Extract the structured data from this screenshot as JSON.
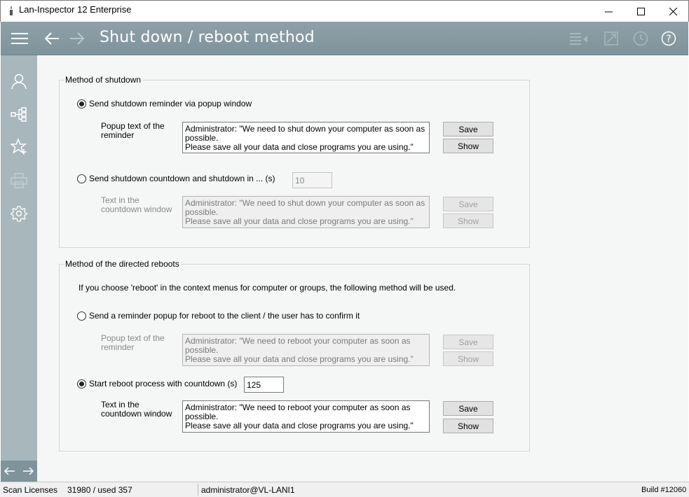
{
  "window": {
    "title": "Lan-Inspector 12 Enterprise"
  },
  "header": {
    "page_title": "Shut down / reboot method"
  },
  "shutdown_group": {
    "title": "Method of shutdown",
    "option_popup": {
      "label": "Send shutdown reminder via popup window",
      "checked": true,
      "text_label": "Popup text of the\nreminder",
      "text_value": "Administrator: \"We need to shut down your computer as soon as possible.\nPlease save all your data and close programs you are using.\"",
      "save_label": "Save",
      "show_label": "Show"
    },
    "option_countdown": {
      "label": "Send shutdown countdown and shutdown in ... (s)",
      "checked": false,
      "seconds": "10",
      "text_label": "Text in the\ncountdown window",
      "text_value": "Administrator: \"We need to shut down your computer as soon as possible.\nPlease save all your data and close programs you are using.\"",
      "save_label": "Save",
      "show_label": "Show"
    }
  },
  "reboot_group": {
    "title": "Method of the directed reboots",
    "info": "If you choose 'reboot' in the context menus for computer or groups, the following method will be used.",
    "option_popup": {
      "label": "Send a reminder popup for reboot to the client / the user has to confirm it",
      "checked": false,
      "text_label": "Popup text of the\nreminder",
      "text_value": "Administrator: \"We need to reboot your computer as soon as possible.\nPlease save all your data and close programs you are using.\"",
      "save_label": "Save",
      "show_label": "Show"
    },
    "option_countdown": {
      "label": "Start reboot process with countdown (s)",
      "checked": true,
      "seconds": "125",
      "text_label": "Text in the\ncountdown window",
      "text_value": "Administrator: \"We need to reboot your computer as soon as possible.\nPlease save all your data and close programs you are using.\"",
      "save_label": "Save",
      "show_label": "Show"
    }
  },
  "statusbar": {
    "licenses_label": "Scan Licenses",
    "licenses_value": "31980 / used 357",
    "user": "administrator@VL-LANI1",
    "build": "Build #12060"
  },
  "colors": {
    "header": "#8ea1a8",
    "sidebar": "#a7b7bb",
    "content_bg": "#f5f6f6"
  },
  "icons": {
    "header": [
      "menu-icon",
      "back-arrow-icon",
      "forward-arrow-icon",
      "list-icon",
      "export-icon",
      "history-icon",
      "help-icon"
    ],
    "sidebar": [
      "user-icon",
      "network-tree-icon",
      "star-add-icon",
      "printer-icon",
      "gear-icon"
    ]
  }
}
